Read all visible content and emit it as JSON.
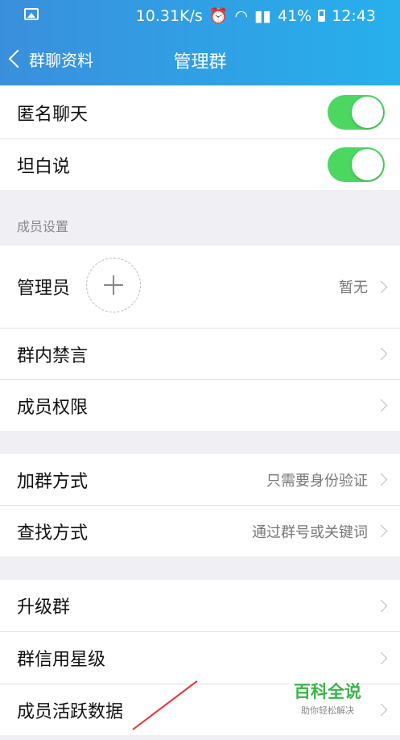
{
  "status_bar": {
    "speed": "10.31K/s",
    "battery": "41%",
    "time": "12:43",
    "icons": [
      "image-icon",
      "alarm-icon",
      "wifi-icon",
      "signal-icon",
      "battery-icon"
    ]
  },
  "nav": {
    "back_label": "群聊资料",
    "title": "管理群"
  },
  "rows": {
    "anonymous": {
      "label": "匿名聊天",
      "enabled": true
    },
    "tanbaishuo": {
      "label": "坦白说",
      "enabled": true
    },
    "member_section_header": "成员设置",
    "admin": {
      "label": "管理员",
      "value": "暂无"
    },
    "mute": {
      "label": "群内禁言"
    },
    "permissions": {
      "label": "成员权限"
    },
    "join_method": {
      "label": "加群方式",
      "value": "只需要身份验证"
    },
    "find_method": {
      "label": "查找方式",
      "value": "通过群号或关键词"
    },
    "upgrade": {
      "label": "升级群"
    },
    "credit": {
      "label": "群信用星级"
    },
    "activity": {
      "label": "成员活跃数据"
    }
  },
  "watermark": {
    "title": "百科全说",
    "subtitle": "助你轻松解决"
  },
  "colors": {
    "accent": "#2d9ee6",
    "toggle_on": "#4bd760",
    "annotation": "#e6322f"
  }
}
